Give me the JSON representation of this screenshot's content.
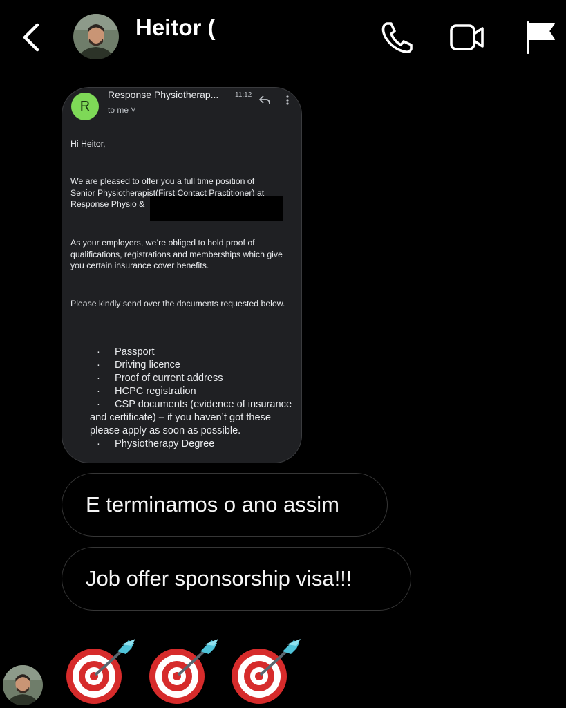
{
  "header": {
    "contact_name": "Heitor (",
    "icons": [
      "back-icon",
      "phone-icon",
      "video-camera-icon",
      "flag-icon"
    ]
  },
  "email": {
    "sender_initial": "R",
    "sender_name": "Response Physiotherap...",
    "time": "11:12",
    "to": "to me ˅",
    "greeting": "Hi Heitor,",
    "para1_lines": [
      "We are pleased to offer you a full time position of",
      "Senior Physiotherapist(First Contact Practitioner) at",
      "Response Physio &"
    ],
    "para2": "As your employers, we’re obliged to hold proof of qualifications, registrations and memberships which give you certain insurance cover benefits.",
    "para3": "Please kindly send over the documents requested below.",
    "bullet_char": "·",
    "documents": [
      "Passport",
      "Driving licence",
      "Proof of current address",
      "HCPC registration",
      "CSP documents (evidence of insurance and certificate) – if you haven’t got these please apply as soon as possible.",
      "Physiotherapy Degree"
    ]
  },
  "messages": [
    {
      "text": "E terminamos o ano assim"
    },
    {
      "text": "Job offer sponsorship visa!!!"
    }
  ],
  "emoji_message": {
    "emoji": [
      "direct-hit",
      "direct-hit",
      "direct-hit"
    ]
  },
  "colors": {
    "background": "#000000",
    "bubble_border": "#363636",
    "email_bg": "#1f2023",
    "sender_avatar": "#7ed957"
  }
}
